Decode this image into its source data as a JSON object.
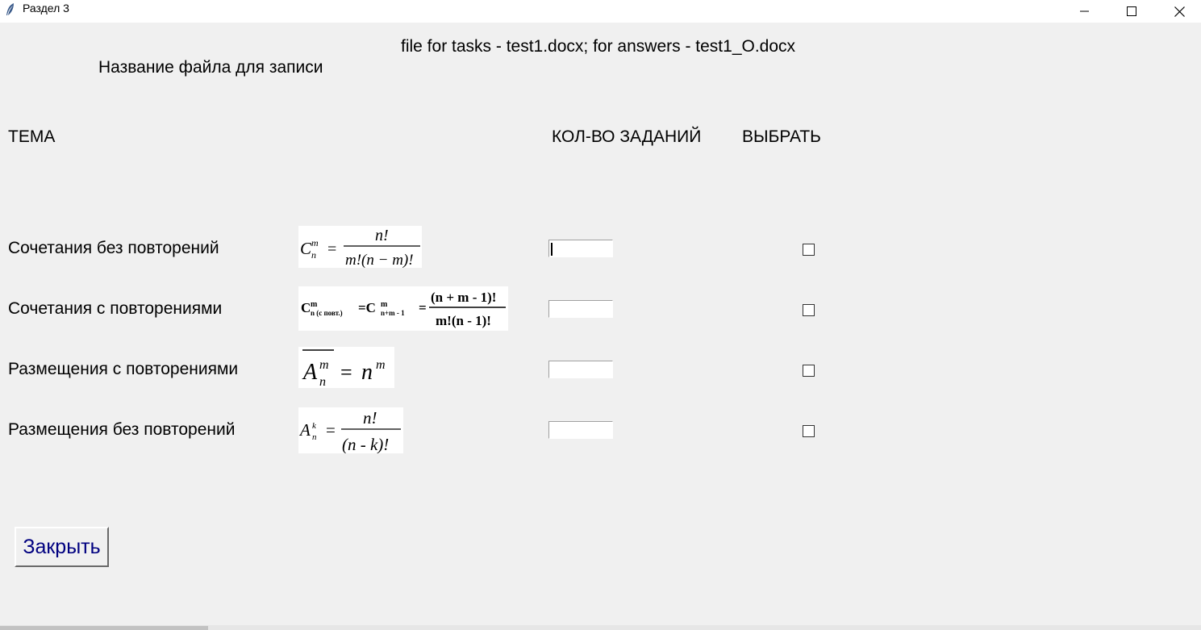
{
  "window": {
    "title": "Раздел 3",
    "icon": "feather-icon",
    "controls": [
      "minimize-icon",
      "maximize-icon",
      "close-icon"
    ]
  },
  "header": {
    "file_info": "file for tasks - test1.docx; for answers - test1_O.docx",
    "filename_label": "Название файла для записи"
  },
  "columns": {
    "topic": "ТЕМА",
    "count": "КОЛ-ВО ЗАДАНИЙ",
    "select": "ВЫБРАТЬ"
  },
  "rows": [
    {
      "label": "Сочетания без повторений",
      "formula": "C_n^m = n! / (m!(n−m)!)",
      "count_value": "",
      "selected": false
    },
    {
      "label": "Сочетания с повторениями",
      "formula": "C^m_n(с повт.) = C^m_n+m-1 = (n + m - 1)! / (m!(n - 1)!)",
      "count_value": "",
      "selected": false
    },
    {
      "label": "Размещения с повторениями",
      "formula": "A̅_n^m = n^m",
      "count_value": "",
      "selected": false
    },
    {
      "label": "Размещения без повторений",
      "formula": "A_n^k = n! / (n - k)!",
      "count_value": "",
      "selected": false
    }
  ],
  "formula_text": {
    "f1_n": "n!",
    "f1_den": "m!(n − m)!",
    "f2_num": "(n + m - 1)!",
    "f2_den": "m!(n - 1)!",
    "f2_sub1": "n (с повт.)",
    "f2_sub2": "n+m - 1",
    "f4_num": "n!",
    "f4_den": "(n -  k)!"
  },
  "close_button": "Закрыть",
  "colors": {
    "background": "#f0f0f0",
    "button_text": "#000080"
  }
}
